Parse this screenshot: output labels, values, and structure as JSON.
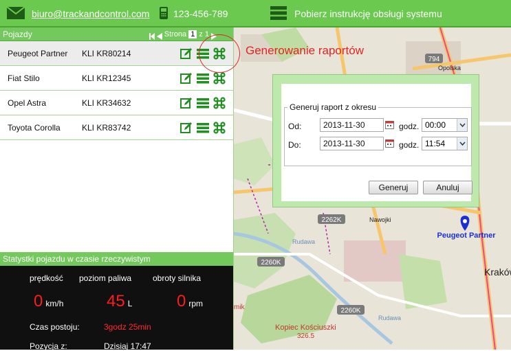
{
  "topbar": {
    "email": "biuro@trackandcontrol.com",
    "phone": "123-456-789",
    "manual": "Pobierz instrukcję obsługi systemu"
  },
  "vehicles_panel": {
    "title": "Pojazdy",
    "pager_label": "Strona",
    "page_current": "1",
    "page_of": "z 1"
  },
  "vehicles": [
    {
      "name": "Peugeot Partner",
      "plate": "KLI KR80214"
    },
    {
      "name": "Fiat Stilo",
      "plate": "KLI KR12345"
    },
    {
      "name": "Opel Astra",
      "plate": "KLI KR34632"
    },
    {
      "name": "Toyota Corolla",
      "plate": "KLI KR83742"
    }
  ],
  "annotation": "Generowanie raportów",
  "stats": {
    "title": "Statystki pojazdu w czasie rzeczywistym",
    "speed_label": "prędkość",
    "fuel_label": "poziom paliwa",
    "rpm_label": "obroty silnika",
    "speed_value": "0",
    "speed_unit": "km/h",
    "fuel_value": "45",
    "fuel_unit": "L",
    "rpm_value": "0",
    "rpm_unit": "rpm",
    "idle_label": "Czas postoju:",
    "idle_value": "3godz 25min",
    "position_label": "Pozycja z:",
    "position_value": "Dzisiaj 17:47"
  },
  "map": {
    "labels": [
      "794",
      "Opolska",
      "2262K",
      "Nawojki",
      "2260K",
      "2260K",
      "Rudawa",
      "Rudawa",
      "Kopiec Kościuszki",
      "326.5",
      "Kraków",
      "mik"
    ],
    "marker_label": "Peugeot Partner"
  },
  "dialog": {
    "legend": "Generuj raport z okresu",
    "from_label": "Od:",
    "from_date": "2013-11-30",
    "from_time_label": "godz.",
    "from_time": "00:00",
    "to_label": "Do:",
    "to_date": "2013-11-30",
    "to_time_label": "godz.",
    "to_time": "11:54",
    "generate_button": "Generuj",
    "cancel_button": "Anuluj"
  },
  "colors": {
    "accent_green": "#6bc94f",
    "header_green": "#74c95c",
    "icon_green": "#1f8f1f",
    "alert_red": "#e42323",
    "marker_blue": "#1a2ed6"
  }
}
